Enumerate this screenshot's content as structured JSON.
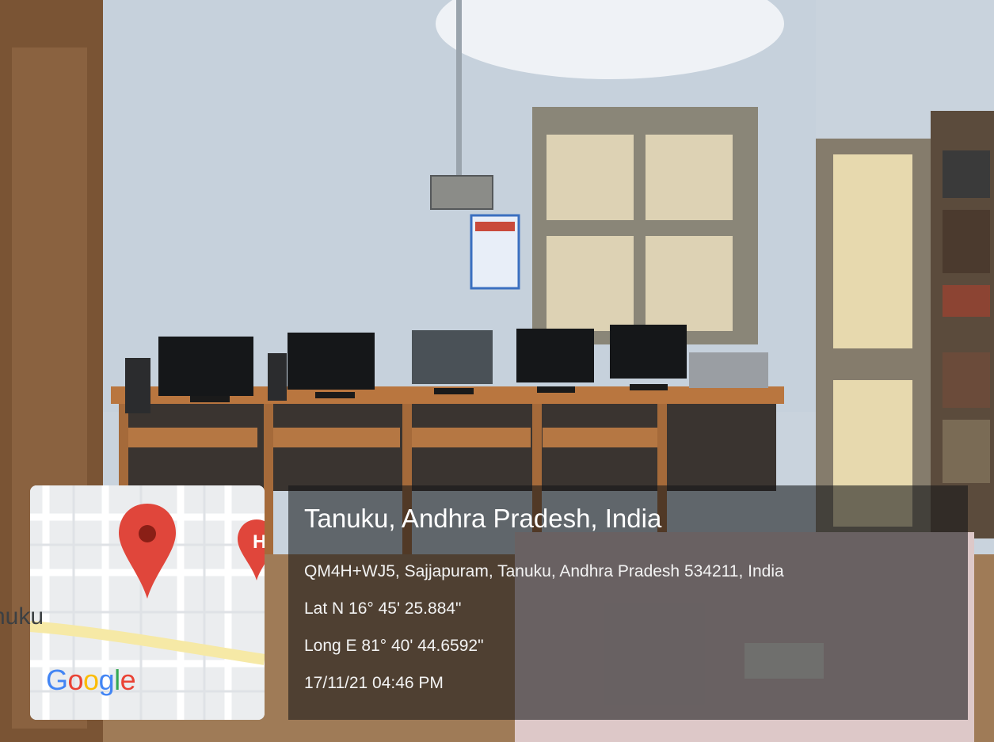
{
  "map": {
    "place_label": "nuku",
    "logo_letters": [
      {
        "char": "G",
        "color": "#4285F4"
      },
      {
        "char": "o",
        "color": "#EA4335"
      },
      {
        "char": "o",
        "color": "#FBBC05"
      },
      {
        "char": "g",
        "color": "#4285F4"
      },
      {
        "char": "l",
        "color": "#34A853"
      },
      {
        "char": "e",
        "color": "#EA4335"
      }
    ],
    "pin_icon": "map-pin-icon",
    "pin_color": "#E0463B",
    "hospital_icon": "hospital-marker-icon",
    "hospital_letter": "H"
  },
  "location": {
    "title": "Tanuku, Andhra Pradesh, India",
    "address": "QM4H+WJ5, Sajjapuram, Tanuku, Andhra Pradesh 534211, India",
    "latitude": "Lat N 16° 45' 25.884\"",
    "longitude": "Long E 81° 40' 44.6592\"",
    "timestamp": "17/11/21 04:46 PM"
  }
}
